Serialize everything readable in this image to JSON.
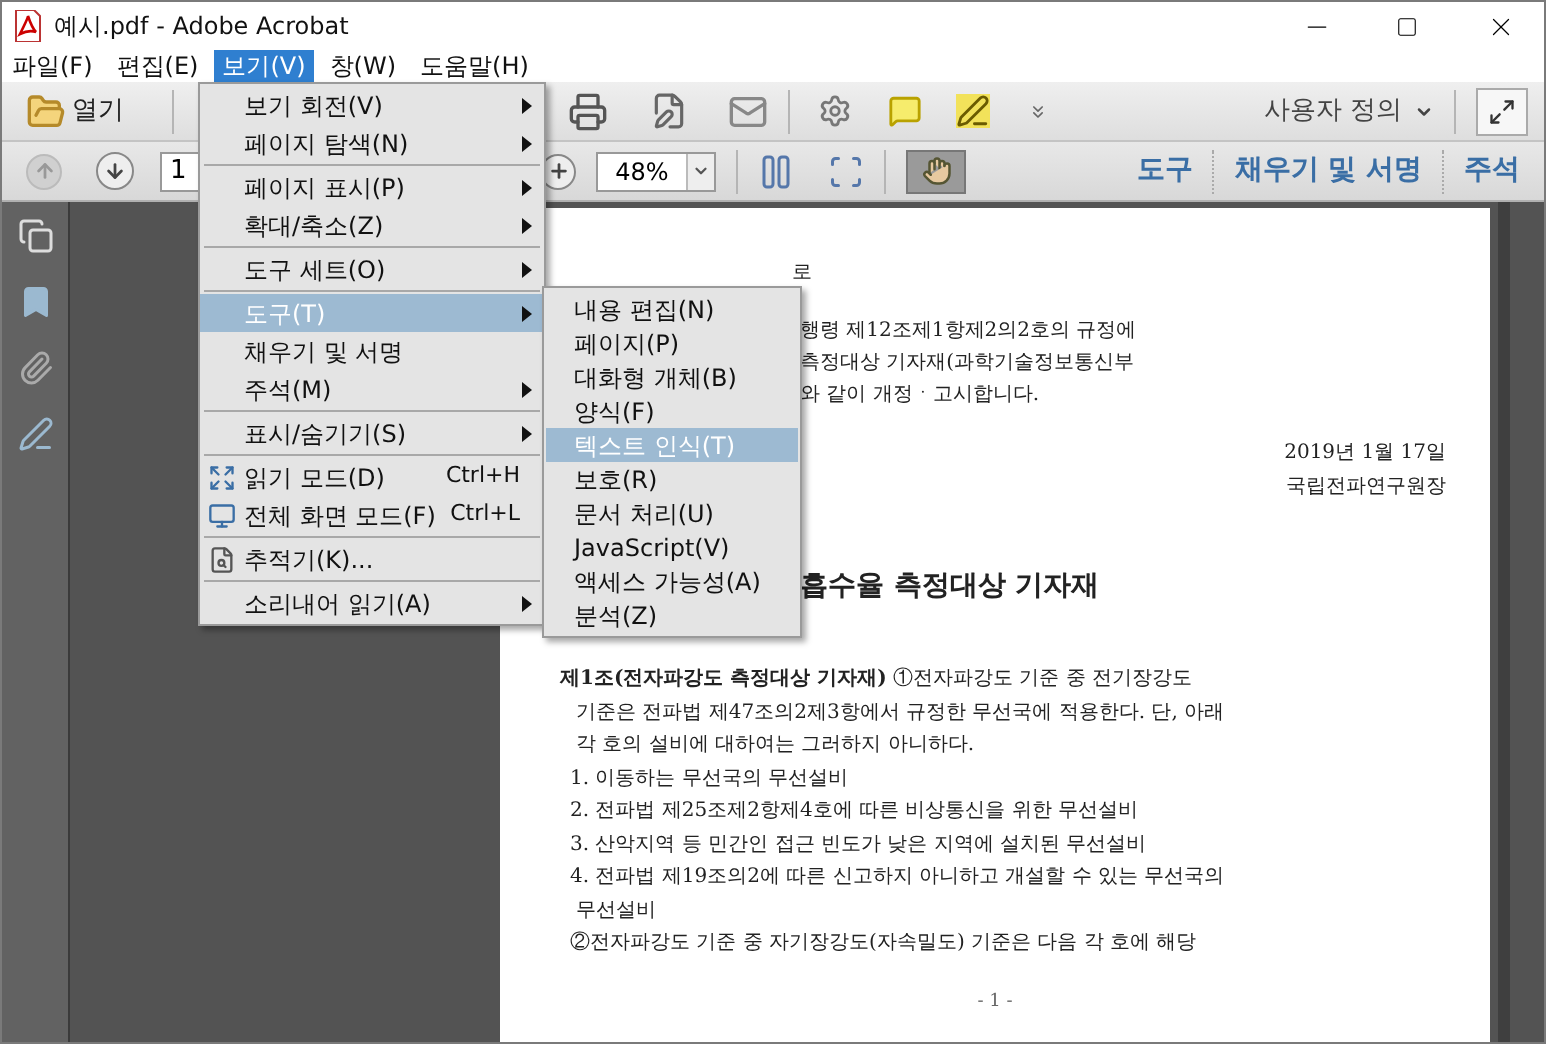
{
  "window": {
    "title": "예시.pdf - Adobe Acrobat"
  },
  "menu_bar": [
    {
      "label": "파일(F)",
      "selected": false
    },
    {
      "label": "편집(E)",
      "selected": false
    },
    {
      "label": "보기(V)",
      "selected": true
    },
    {
      "label": "창(W)",
      "selected": false
    },
    {
      "label": "도움말(H)",
      "selected": false
    }
  ],
  "toolbar": {
    "open_button": "열기",
    "customize": "사용자 정의"
  },
  "nav_bar": {
    "page": "1",
    "zoom": "48%",
    "hand_tool_active": true,
    "panes": [
      {
        "label": "도구",
        "selected": false
      },
      {
        "label": "채우기 및 서명",
        "selected": false
      },
      {
        "label": "주석",
        "selected": false
      }
    ]
  },
  "view_menu": [
    {
      "kind": "item",
      "label": "보기 회전(V)",
      "submenu": true,
      "selected": false
    },
    {
      "kind": "item",
      "label": "페이지 탐색(N)",
      "submenu": true,
      "selected": false
    },
    {
      "kind": "separator"
    },
    {
      "kind": "item",
      "label": "페이지 표시(P)",
      "submenu": true,
      "selected": false
    },
    {
      "kind": "item",
      "label": "확대/축소(Z)",
      "submenu": true,
      "selected": false
    },
    {
      "kind": "separator"
    },
    {
      "kind": "item",
      "label": "도구 세트(O)",
      "submenu": true,
      "selected": false
    },
    {
      "kind": "separator"
    },
    {
      "kind": "item",
      "label": "도구(T)",
      "submenu": true,
      "selected": true
    },
    {
      "kind": "item",
      "label": "채우기 및 서명",
      "submenu": false,
      "selected": false
    },
    {
      "kind": "item",
      "label": "주석(M)",
      "submenu": true,
      "selected": false
    },
    {
      "kind": "separator"
    },
    {
      "kind": "item",
      "label": "표시/숨기기(S)",
      "submenu": true,
      "selected": false
    },
    {
      "kind": "separator"
    },
    {
      "kind": "icon_item",
      "label": "읽기 모드(D)",
      "shortcut": "Ctrl+H",
      "submenu": false,
      "selected": false
    },
    {
      "kind": "icon_item",
      "label": "전체 화면 모드(F)",
      "shortcut": "Ctrl+L",
      "submenu": false,
      "selected": false
    },
    {
      "kind": "separator"
    },
    {
      "kind": "icon_item",
      "label": "추적기(K)...",
      "submenu": false,
      "selected": false
    },
    {
      "kind": "separator"
    },
    {
      "kind": "item",
      "label": "소리내어 읽기(A)",
      "submenu": true,
      "selected": false
    }
  ],
  "tools_submenu": [
    {
      "label": "내용 편집(N)",
      "selected": false
    },
    {
      "label": "페이지(P)",
      "selected": false
    },
    {
      "label": "대화형 개체(B)",
      "selected": false
    },
    {
      "label": "양식(F)",
      "selected": false
    },
    {
      "label": "텍스트 인식(T)",
      "selected": true
    },
    {
      "label": "보호(R)",
      "selected": false
    },
    {
      "label": "문서 처리(U)",
      "selected": false
    },
    {
      "label": "JavaScript(V)",
      "selected": false
    },
    {
      "label": "액세스 가능성(A)",
      "selected": false
    },
    {
      "label": "분석(Z)",
      "selected": false
    }
  ],
  "document": {
    "header_fragment": "로",
    "header_lines": [
      "행령 제12조제1항제2의2호의 규정에",
      "측정대상 기자재(과학기술정보통신부",
      "와 같이 개정ㆍ고시합니다."
    ],
    "date": "2019년 1월 17일",
    "signer": "국립전파연구원장",
    "heading": "흡수율 측정대상 기자재",
    "lines": [
      {
        "kind": "first",
        "text": "**제1조(전자파강도 측정대상 기자재)** ①전자파강도 기준 중 전기장강도"
      },
      {
        "kind": "cont",
        "text": "기준은 전파법 제47조의2제3항에서 규정한 무선국에 적용한다. 단, 아래"
      },
      {
        "kind": "cont",
        "text": "각 호의 설비에 대하여는 그러하지 아니하다."
      },
      {
        "kind": "item",
        "text": "1. 이동하는 무선국의 무선설비"
      },
      {
        "kind": "item",
        "text": "2. 전파법 제25조제2항제4호에 따른 비상통신을 위한 무선설비"
      },
      {
        "kind": "item",
        "text": "3. 산악지역 등 민간인 접근 빈도가 낮은 지역에 설치된 무선설비"
      },
      {
        "kind": "item",
        "text": "4. 전파법 제19조의2에 따른 신고하지 아니하고 개설할 수 있는 무선국의"
      },
      {
        "kind": "cont",
        "text": "무선설비"
      },
      {
        "kind": "item",
        "text": "②전자파강도 기준 중 자기장강도(자속밀도) 기준은 다음 각 호에 해당"
      }
    ],
    "page_number": "- 1 -"
  }
}
